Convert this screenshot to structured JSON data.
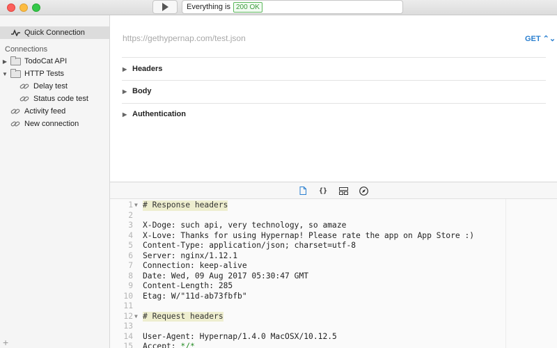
{
  "titlebar": {
    "status_text": "Everything is",
    "status_badge": "200 OK"
  },
  "sidebar": {
    "quick_connection": "Quick Connection",
    "connections_heading": "Connections",
    "items": [
      {
        "label": "TodoCat API",
        "type": "folder",
        "expanded": false
      },
      {
        "label": "HTTP Tests",
        "type": "folder",
        "expanded": true
      },
      {
        "label": "Delay test",
        "type": "link",
        "indent": true
      },
      {
        "label": "Status code test",
        "type": "link",
        "indent": true
      },
      {
        "label": "Activity feed",
        "type": "link"
      },
      {
        "label": "New connection",
        "type": "link"
      }
    ],
    "add_symbol": "+"
  },
  "request": {
    "url_placeholder": "https://gethypernap.com/test.json",
    "method": "GET ⌃⌄",
    "sections": [
      "Headers",
      "Body",
      "Authentication"
    ]
  },
  "response": {
    "toolbar_icons": [
      "document-icon",
      "braces-icon",
      "layout-icon",
      "compass-icon"
    ],
    "lines": [
      {
        "n": "1",
        "text": "# Response headers",
        "fold": true,
        "comment": true
      },
      {
        "n": "2",
        "text": ""
      },
      {
        "n": "3",
        "text": "X-Doge: such api, very technology, so amaze"
      },
      {
        "n": "4",
        "text": "X-Love: Thanks for using Hypernap! Please rate the app on App Store :)"
      },
      {
        "n": "5",
        "text": "Content-Type: application/json; charset=utf-8"
      },
      {
        "n": "6",
        "text": "Server: nginx/1.12.1"
      },
      {
        "n": "7",
        "text": "Connection: keep-alive"
      },
      {
        "n": "8",
        "text": "Date: Wed, 09 Aug 2017 05:30:47 GMT"
      },
      {
        "n": "9",
        "text": "Content-Length: 285"
      },
      {
        "n": "10",
        "text": "Etag: W/\"11d-ab73fbfb\""
      },
      {
        "n": "11",
        "text": ""
      },
      {
        "n": "12",
        "text": "# Request headers",
        "fold": true,
        "comment": true
      },
      {
        "n": "13",
        "text": ""
      },
      {
        "n": "14",
        "text": "User-Agent: Hypernap/1.4.0 MacOSX/10.12.5"
      },
      {
        "n": "15",
        "text": "Accept: ",
        "green": "*/*"
      }
    ]
  },
  "colors": {
    "accent": "#2a7fd0",
    "status_green": "#3c9a3c",
    "comment_bg": "#eeeecf"
  }
}
